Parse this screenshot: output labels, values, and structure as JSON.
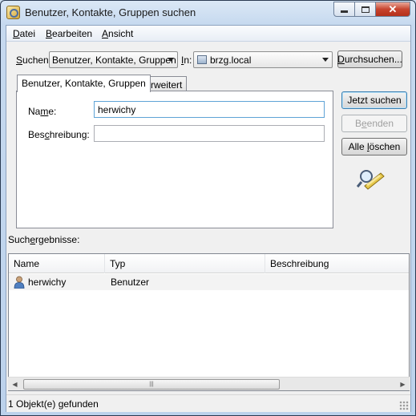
{
  "window": {
    "title": "Benutzer, Kontakte, Gruppen suchen",
    "app_icon": "find-people-icon"
  },
  "menu": {
    "datei": {
      "ul": "D",
      "rest": "atei"
    },
    "bearbeiten": {
      "ul": "B",
      "rest": "earbeiten"
    },
    "ansicht": {
      "ul": "A",
      "rest": "nsicht"
    }
  },
  "search_bar": {
    "suchen_label_ul": "S",
    "suchen_label_rest": "uchen:",
    "suchen_value": "Benutzer, Kontakte, Gruppen",
    "in_label_ul": "I",
    "in_label_rest": "n:",
    "in_value": "brzg.local",
    "browse_ul": "D",
    "browse_rest": "urchsuchen..."
  },
  "tabs": [
    {
      "label": "Benutzer, Kontakte, Gruppen",
      "active": true
    },
    {
      "label": "Erweitert",
      "active": false
    }
  ],
  "form": {
    "name_label_a": "Na",
    "name_label_ul": "m",
    "name_label_b": "e:",
    "name_value": "herwichy",
    "desc_label_a": "Bes",
    "desc_label_ul": "c",
    "desc_label_b": "hreibung:",
    "desc_value": ""
  },
  "buttons": {
    "search_now": "Jetzt suchen",
    "stop_a": "B",
    "stop_ul": "e",
    "stop_b": "enden",
    "clear_a": "Alle ",
    "clear_ul": "l",
    "clear_b": "öschen"
  },
  "results": {
    "label_a": "Such",
    "label_ul": "e",
    "label_b": "rgebnisse:",
    "columns": [
      "Name",
      "Typ",
      "Beschreibung"
    ],
    "rows": [
      {
        "name": "herwichy",
        "type": "Benutzer",
        "description": "",
        "icon": "user-icon"
      }
    ]
  },
  "status": {
    "text": "1 Objekt(e) gefunden"
  }
}
